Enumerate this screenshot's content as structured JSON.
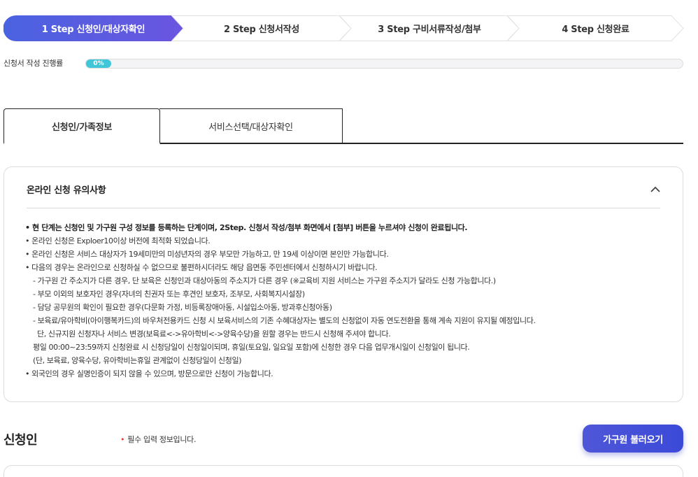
{
  "stepper": {
    "steps": [
      {
        "label": "1 Step 신청인/대상자확인",
        "active": true
      },
      {
        "label": "2 Step 신청서작성",
        "active": false
      },
      {
        "label": "3 Step 구비서류작성/첨부",
        "active": false
      },
      {
        "label": "4 Step 신청완료",
        "active": false
      }
    ],
    "colors": {
      "active_start": "#4a63e0",
      "active_end": "#6b55e0",
      "inactive_border": "#e2e2e2"
    }
  },
  "progress": {
    "label": "신청서 작성 진행률",
    "value_text": "0%",
    "value": 0,
    "color": "#3fc6d8"
  },
  "tabs": [
    {
      "label": "신청인/가족정보",
      "active": true
    },
    {
      "label": "서비스선택/대상자확인",
      "active": false
    }
  ],
  "notice": {
    "title": "온라인 신청 유의사항",
    "toggle_icon": "chevron-up-icon",
    "lines": [
      {
        "text": "• 현 단계는 신청인 및 가구원 구성 정보를 등록하는 단계이며, 2Step. 신청서 작성/첨부 화면에서 [첨부] 버튼을 누르셔야 신청이 완료됩니다.",
        "style": "bold"
      },
      {
        "text": "• 온라인 신청은 Exploer10이상 버전에 최적화 되었습니다.",
        "style": "normal"
      },
      {
        "text": "• 온라인 신청은 서비스 대상자가 19세미만의 미성년자의 경우 부모만 가능하고, 만 19세 이상이면 본인만 가능합니다.",
        "style": "normal"
      },
      {
        "text": "• 다음의 경우는 온라인으로 신청하실 수 없으므로 불편하시더라도 해당 읍면동 주민센터에서 신청하시기 바랍니다.",
        "style": "normal"
      },
      {
        "text": "- 가구원 간 주소지가 다른 경우, 단 보육은 신청인과 대상아동의 주소지가 다른 경우 (※교육비 지원 서비스는 가구원 주소지가 달라도 신청 가능합니다.)",
        "style": "sub"
      },
      {
        "text": "- 부모 이외의 보호자인 경우(자녀의 친권자 또는 후견인 보호자, 조부모, 사회복지시설장)",
        "style": "sub"
      },
      {
        "text": "- 담당 공무원의 확인이 필요한 경우(다문화 가정, 비등록장애아동, 시설입소아동, 방과후신청아동)",
        "style": "sub"
      },
      {
        "text": "- 보육료/유아학비(아이행복카드)의 바우처전용카드 신청 시 보육서비스의 기존 수혜대상자는 별도의 신청없이 자동 연도전환을 통해 계속 지원이 유지될 예정입니다.",
        "style": "sub"
      },
      {
        "text": "단, 신규지원 신청자나 서비스 변경(보육료<->유아학비<->양육수당)을 원할 경우는 반드시 신청해 주셔야 합니다.",
        "style": "sub2"
      },
      {
        "text": "평일 00:00~23:59까지 신청완료 시 신청당일이 신청일이되며, 휴일(토요일, 일요일 포함)에 신청한 경우 다음 업무개시일이 신청일이 됩니다.",
        "style": "sub"
      },
      {
        "text": "(단, 보육료, 양육수당, 유아학비는휴일 관계없이 신청당일이 신청일)",
        "style": "sub"
      },
      {
        "text": "• 외국인의 경우 실명인증이 되지 않을 수 있으며, 방문으로만 신청이 가능합니다.",
        "style": "normal"
      }
    ]
  },
  "applicant": {
    "title": "신청인",
    "required_note": "필수 입력 정보입니다.",
    "required_marker": "•",
    "load_button": "가구원 불러오기"
  }
}
